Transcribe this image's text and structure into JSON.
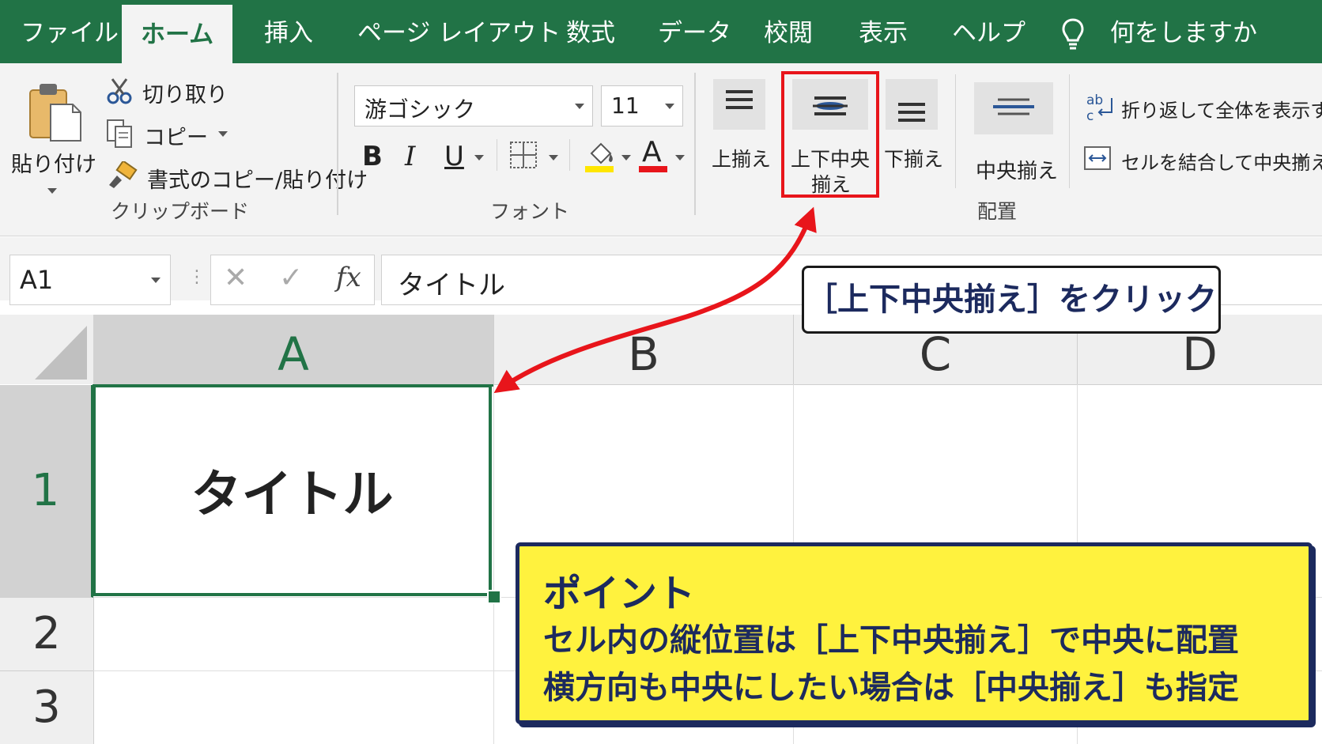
{
  "tabs": [
    {
      "label": "ファイル",
      "active": false
    },
    {
      "label": "ホーム",
      "active": true
    },
    {
      "label": "挿入",
      "active": false
    },
    {
      "label": "ページ レイアウト",
      "active": false
    },
    {
      "label": "数式",
      "active": false
    },
    {
      "label": "データ",
      "active": false
    },
    {
      "label": "校閲",
      "active": false
    },
    {
      "label": "表示",
      "active": false
    },
    {
      "label": "ヘルプ",
      "active": false
    }
  ],
  "tell_me": "何をしますか",
  "clipboard": {
    "paste": "貼り付け",
    "cut": "切り取り",
    "copy": "コピー",
    "format_painter": "書式のコピー/貼り付け",
    "group": "クリップボード"
  },
  "font": {
    "name": "游ゴシック",
    "size": "11",
    "bold": "B",
    "italic": "I",
    "underline": "U",
    "font_color_glyph": "A",
    "group": "フォント"
  },
  "alignment": {
    "top": "上揃え",
    "middle_line1": "上下中央",
    "middle_line2": "揃え",
    "bottom": "下揃え",
    "center": "中央揃え",
    "wrap": "折り返して全体を表示する",
    "merge": "セルを結合して中央揃え",
    "group": "配置"
  },
  "formula_bar": {
    "name_box": "A1",
    "fx": "fx",
    "value": "タイトル"
  },
  "columns": [
    "A",
    "B",
    "C",
    "D"
  ],
  "rows": [
    "1",
    "2",
    "3"
  ],
  "cells": {
    "A1": "タイトル"
  },
  "callout_click": "［上下中央揃え］をクリック",
  "point": {
    "heading": "ポイント",
    "line1": "セル内の縦位置は［上下中央揃え］で中央に配置",
    "line2": "横方向も中央にしたい場合は［中央揃え］も指定"
  },
  "colors": {
    "excel_green": "#217346",
    "highlight_red": "#e8151b",
    "callout_yellow": "#fff23e",
    "callout_navy": "#1c2a5e"
  }
}
